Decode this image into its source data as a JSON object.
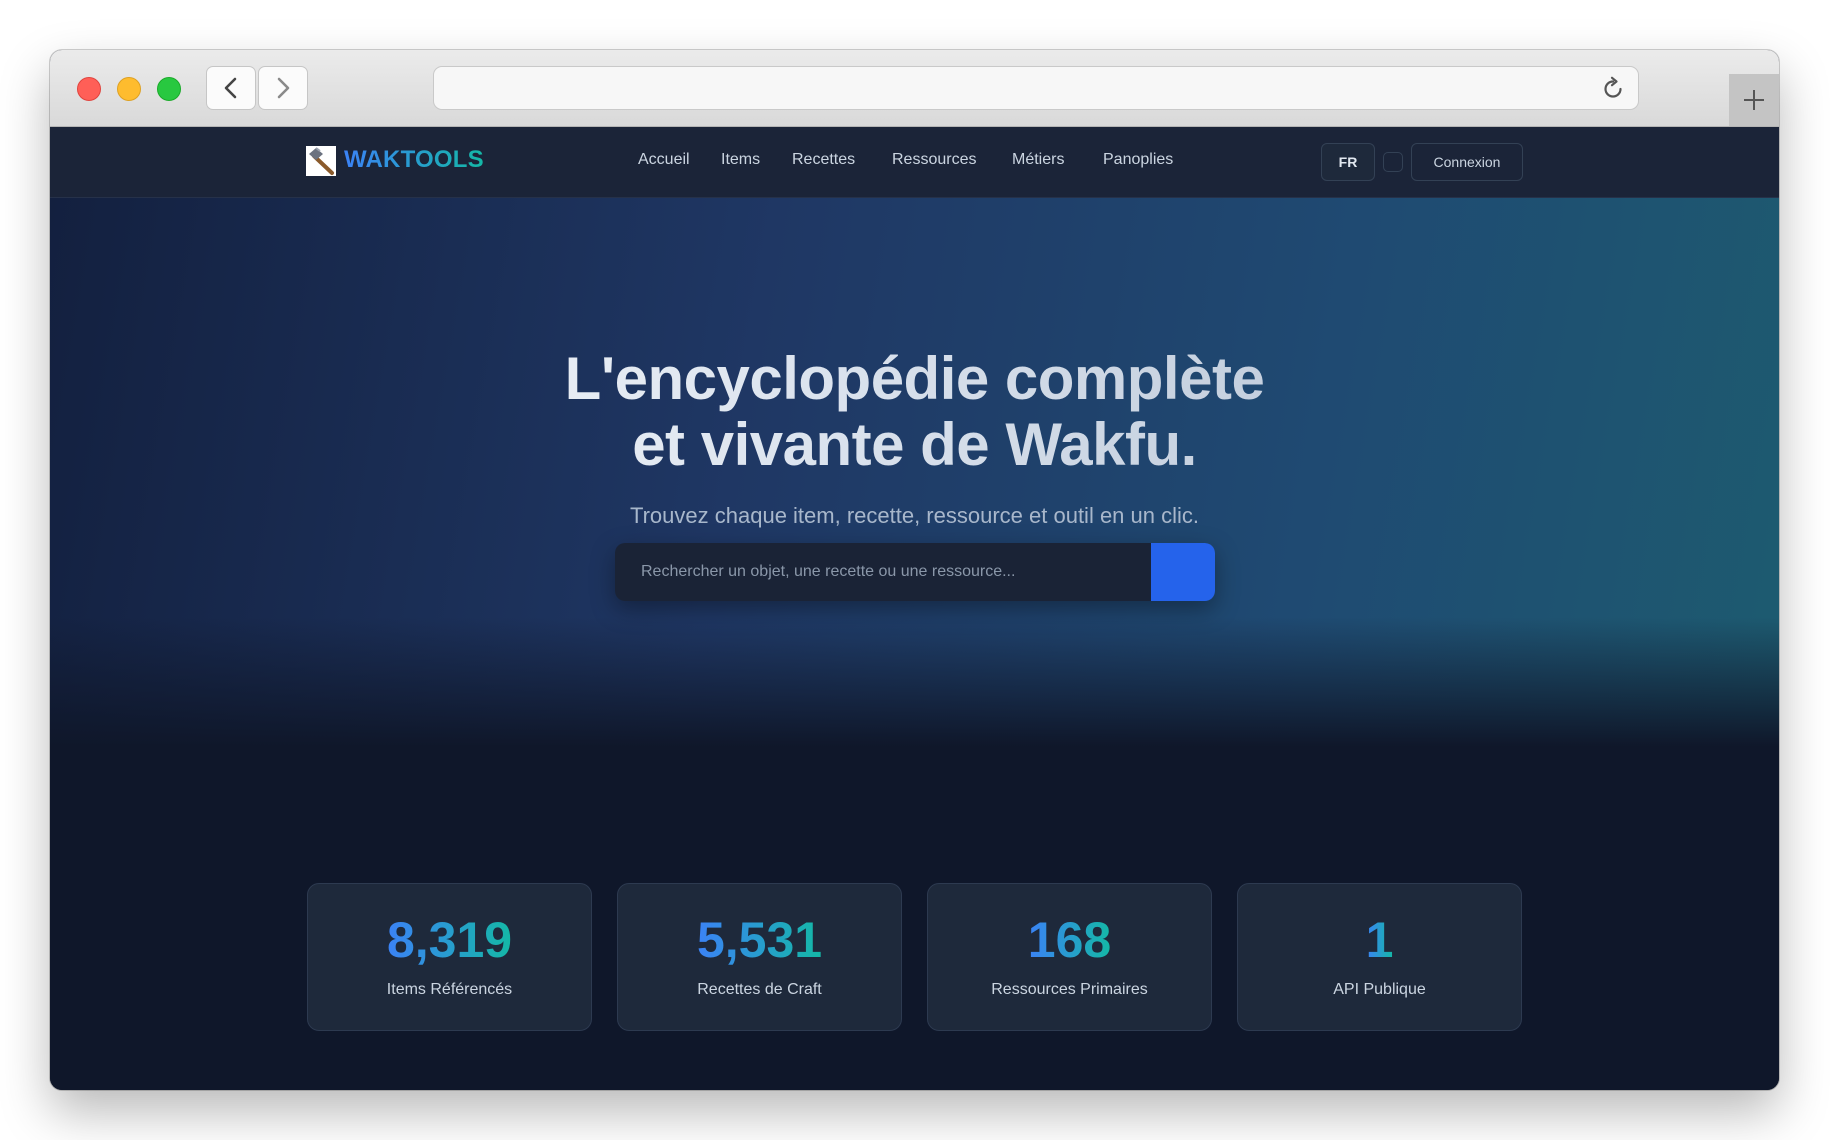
{
  "brand": {
    "name": "WAKTOOLS",
    "logo_icon": "hammer-icon"
  },
  "nav": {
    "links": [
      {
        "label": "Accueil"
      },
      {
        "label": "Items"
      },
      {
        "label": "Recettes"
      },
      {
        "label": "Ressources"
      },
      {
        "label": "Métiers"
      },
      {
        "label": "Panoplies"
      }
    ],
    "lang": "FR",
    "login": "Connexion"
  },
  "hero": {
    "title_line1": "L'encyclopédie complète",
    "title_line2": "et vivante de Wakfu.",
    "subtitle": "Trouvez chaque item, recette, ressource et outil en un clic.",
    "search_placeholder": "Rechercher un objet, une recette ou une ressource..."
  },
  "stats": [
    {
      "value": "8,319",
      "label": "Items Référencés"
    },
    {
      "value": "5,531",
      "label": "Recettes de Craft"
    },
    {
      "value": "168",
      "label": "Ressources Primaires"
    },
    {
      "value": "1",
      "label": "API Publique"
    }
  ],
  "colors": {
    "accent_blue": "#3b82f6",
    "accent_teal": "#14b8a6",
    "page_bg": "#0f172a",
    "card_bg": "#1e293b",
    "search_button": "#2563eb"
  }
}
